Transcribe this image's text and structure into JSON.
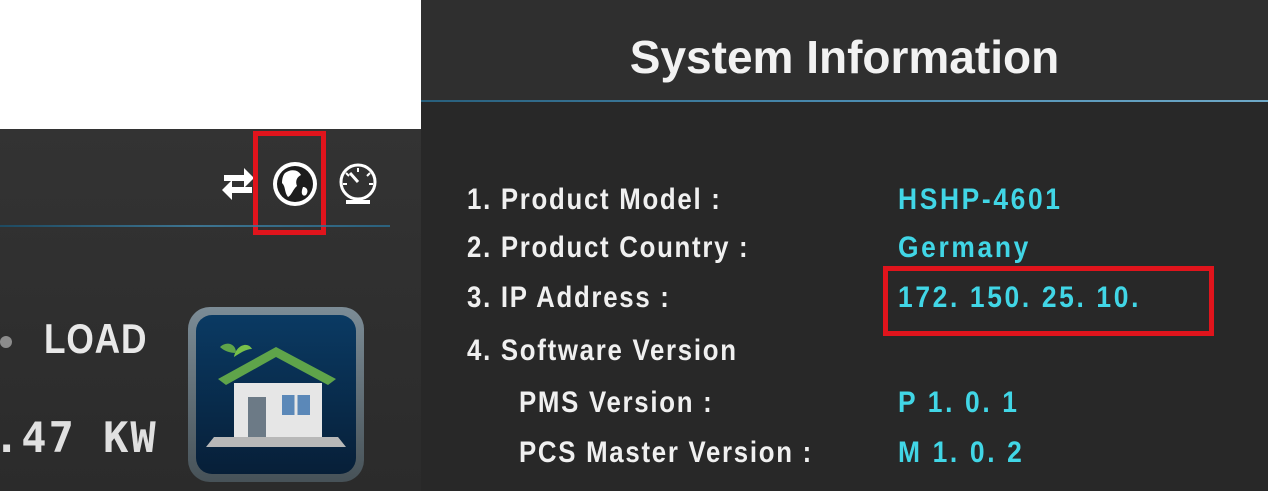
{
  "left_panel": {
    "load": {
      "label": "LOAD",
      "value": ".47 KW"
    },
    "icons": {
      "sync": "sync-arrows-icon",
      "globe": "globe-icon",
      "gauge": "gauge-icon",
      "house": "house-icon"
    },
    "highlight_color": "#e0141c"
  },
  "system_info": {
    "title": "System Information",
    "rows": [
      {
        "label": "1. Product Model :",
        "value": "HSHP-4601"
      },
      {
        "label": "2. Product Country :",
        "value": "Germany"
      },
      {
        "label": "3. IP Address :",
        "value": "172. 150. 25. 10."
      },
      {
        "label": "4. Software Version",
        "value": ""
      },
      {
        "label": "PMS Version :",
        "value": "P 1. 0. 1"
      },
      {
        "label": "PCS Master Version :",
        "value": "M 1. 0. 2"
      }
    ],
    "value_color": "#41d6e6"
  }
}
